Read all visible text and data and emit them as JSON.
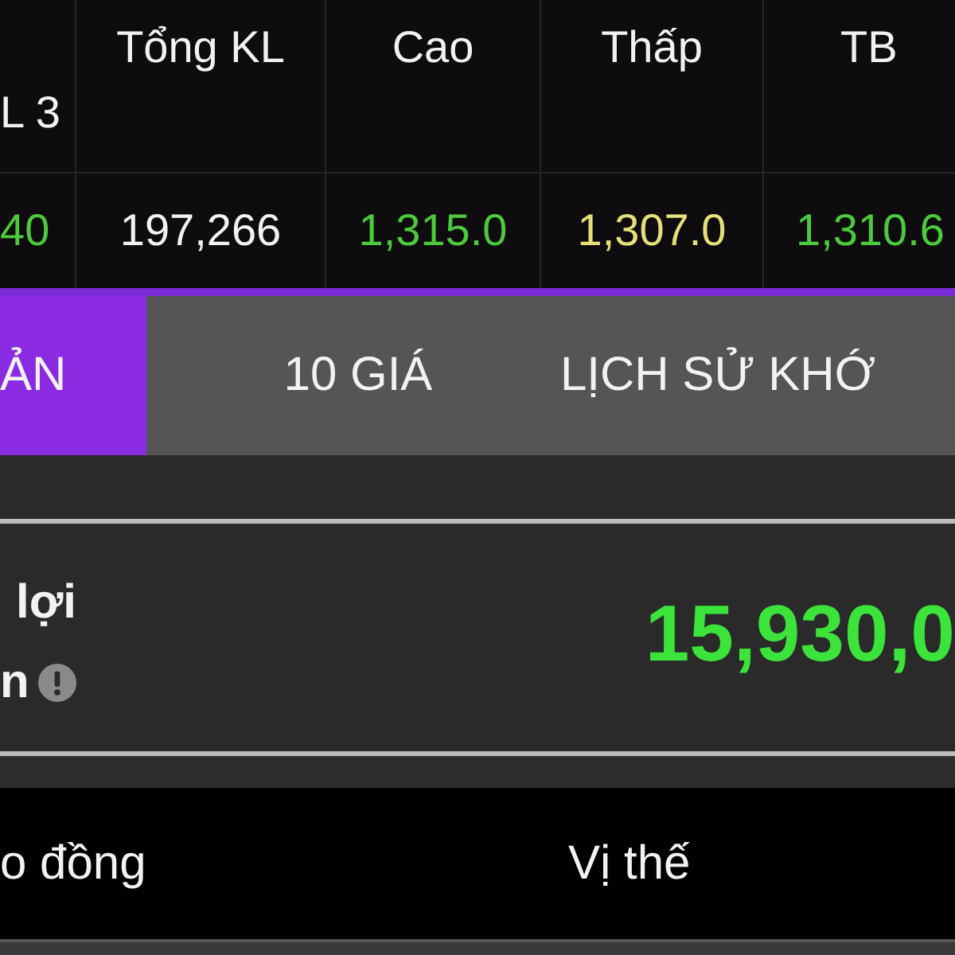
{
  "table": {
    "columns": [
      {
        "label": "L 3"
      },
      {
        "label": "Tổng KL"
      },
      {
        "label": "Cao"
      },
      {
        "label": "Thấp"
      },
      {
        "label": "TB"
      }
    ],
    "rows": [
      [
        {
          "text": "40",
          "color": "#4cc93c"
        },
        {
          "text": "197,266",
          "color": "#f2f2f2"
        },
        {
          "text": "1,315.0",
          "color": "#4cc93c"
        },
        {
          "text": "1,307.0",
          "color": "#e6e07a"
        },
        {
          "text": "1,310.6",
          "color": "#4cc93c"
        }
      ]
    ]
  },
  "tabs": [
    {
      "label": "ẢN",
      "selected": true
    },
    {
      "label": "10 GIÁ",
      "selected": false
    },
    {
      "label": "LỊCH SỬ KHỚ",
      "selected": false
    }
  ],
  "summary": {
    "label_line_1": "lợi",
    "label_line_2": "n",
    "value": "15,930,0"
  },
  "positions": {
    "columns": [
      "o đồng",
      "Vị thế"
    ]
  }
}
